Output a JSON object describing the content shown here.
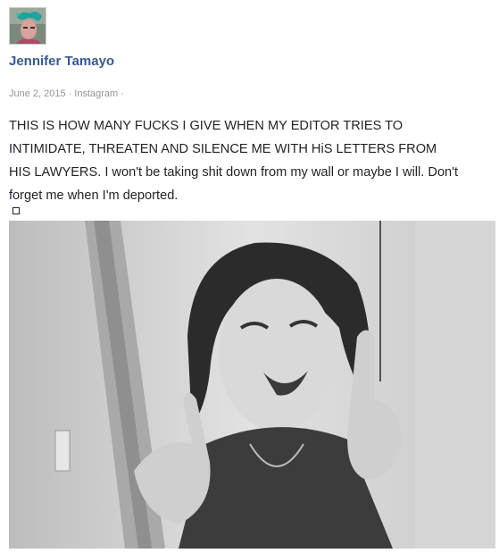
{
  "post": {
    "author": "Jennifer Tamayo",
    "date": "June 2, 2015",
    "source": "Instagram",
    "separator": "·",
    "text_lines": [
      "THIS IS HOW MANY FUCKS I GIVE WHEN MY EDITOR TRIES TO",
      "INTIMIDATE, THREATEN AND SILENCE ME WITH HiS LETTERS FROM",
      "HIS LAWYERS. I won't be taking shit down from my wall or maybe I will. Don't",
      "forget me when I'm deported."
    ]
  },
  "icons": {
    "avatar": "profile-picture",
    "emoji": "unrendered-emoji-box"
  }
}
